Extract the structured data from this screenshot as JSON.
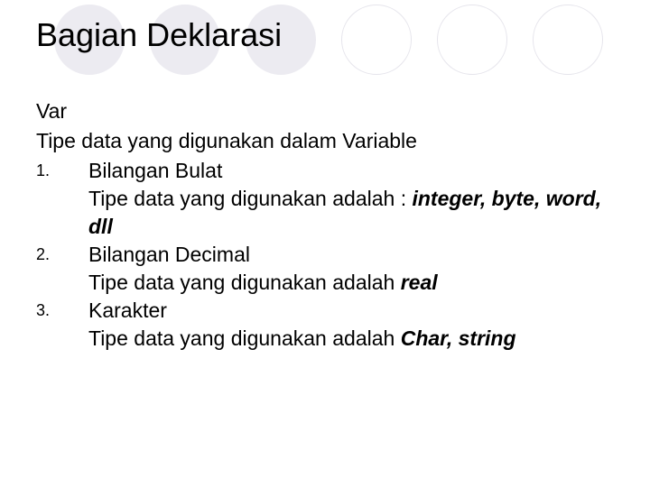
{
  "title": "Bagian Deklarasi",
  "intro_line1": "Var",
  "intro_line2": "Tipe data yang digunakan dalam Variable",
  "items": [
    {
      "num": "1.",
      "heading": "Bilangan Bulat",
      "desc_prefix": "Tipe data yang digunakan adalah : ",
      "desc_strong": "integer, byte, word, dll"
    },
    {
      "num": "2.",
      "heading": "Bilangan Decimal",
      "desc_prefix": "Tipe data yang digunakan adalah ",
      "desc_strong": "real"
    },
    {
      "num": "3.",
      "heading": "Karakter",
      "desc_prefix": "Tipe data yang digunakan adalah ",
      "desc_strong": "Char, string"
    }
  ]
}
